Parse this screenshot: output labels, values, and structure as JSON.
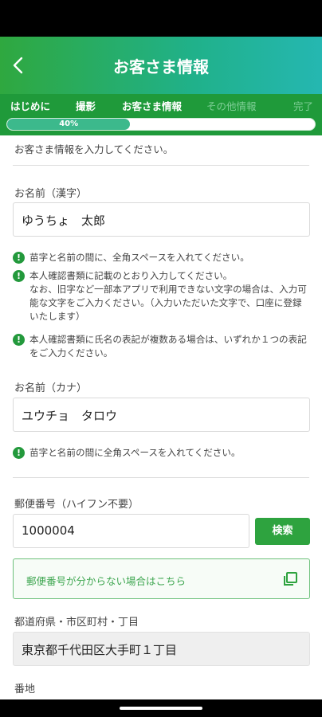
{
  "header": {
    "title": "お客さま情報"
  },
  "steps": [
    {
      "label": "はじめに",
      "active": true
    },
    {
      "label": "撮影",
      "active": true
    },
    {
      "label": "お客さま情報",
      "active": true
    },
    {
      "label": "その他情報",
      "active": false
    },
    {
      "label": "完了",
      "active": false
    }
  ],
  "progress": {
    "percent": 40,
    "label": "40%"
  },
  "form": {
    "intro": "お客さま情報を入力してください。",
    "name_kanji": {
      "label": "お名前（漢字）",
      "value": "ゆうちょ　太郎"
    },
    "name_kanji_notes": [
      "苗字と名前の間に、全角スペースを入れてください。",
      "本人確認書類に記載のとおり入力してください。\nなお、旧字など一部本アプリで利用できない文字の場合は、入力可能な文字をご入力ください。（入力いただいた文字で、口座に登録いたします）",
      "本人確認書類に氏名の表記が複数ある場合は、いずれか１つの表記をご入力ください。"
    ],
    "name_kana": {
      "label": "お名前（カナ）",
      "value": "ユウチョ　タロウ"
    },
    "name_kana_note": "苗字と名前の間に全角スペースを入れてください。",
    "postal": {
      "label": "郵便番号（ハイフン不要）",
      "value": "1000004",
      "search_label": "検索"
    },
    "postal_link": "郵便番号が分からない場合はこちら",
    "prefecture": {
      "label": "都道府県・市区町村・丁目",
      "value": "東京都千代田区大手町１丁目"
    },
    "banchi": {
      "label": "番地"
    }
  },
  "colors": {
    "brand_green": "#2ea33f",
    "header_gradient_end": "#25b7b1"
  },
  "icons": {
    "back": "chevron-left-icon",
    "note": "exclamation-circle-icon",
    "external": "external-link-icon"
  }
}
